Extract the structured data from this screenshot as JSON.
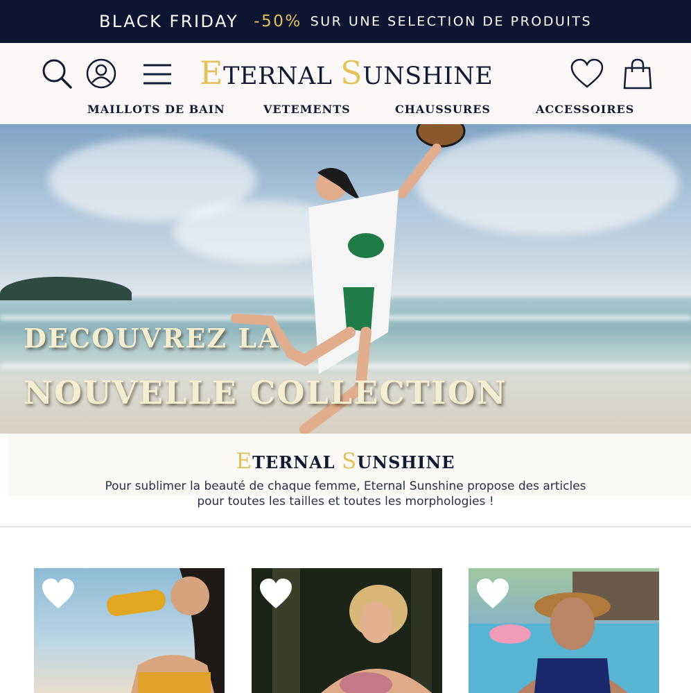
{
  "promo": {
    "label": "BLACK FRIDAY",
    "discount": "-50%",
    "text": "SUR UNE SELECTION DE PRODUITS"
  },
  "logo": {
    "e_cap": "E",
    "e_rest": "TERNAL",
    "s_cap": "S",
    "s_rest": "UNSHINE"
  },
  "icons": [
    "search-icon",
    "account-icon",
    "menu-icon",
    "heart-icon",
    "shopping-bag-icon"
  ],
  "nav": {
    "items": [
      {
        "label": "MAILLOTS DE BAIN"
      },
      {
        "label": "VETEMENTS"
      },
      {
        "label": "CHAUSSURES"
      },
      {
        "label": "ACCESSOIRES"
      }
    ]
  },
  "hero": {
    "line1": "DECOUVREZ LA",
    "line2": "NOUVELLE COLLECTION"
  },
  "brand": {
    "e_cap": "E",
    "e_rest": "TERNAL",
    "s_cap": "S",
    "s_rest": "UNSHINE",
    "description_line1": "Pour sublimer la beauté de chaque femme, Eternal Sunshine propose des articles",
    "description_line2": "pour toutes les tailles et toutes les morphologies !"
  },
  "colors": {
    "navy": "#0d1530",
    "gold": "#e3c25c",
    "header_bg": "#fdf8f8"
  }
}
